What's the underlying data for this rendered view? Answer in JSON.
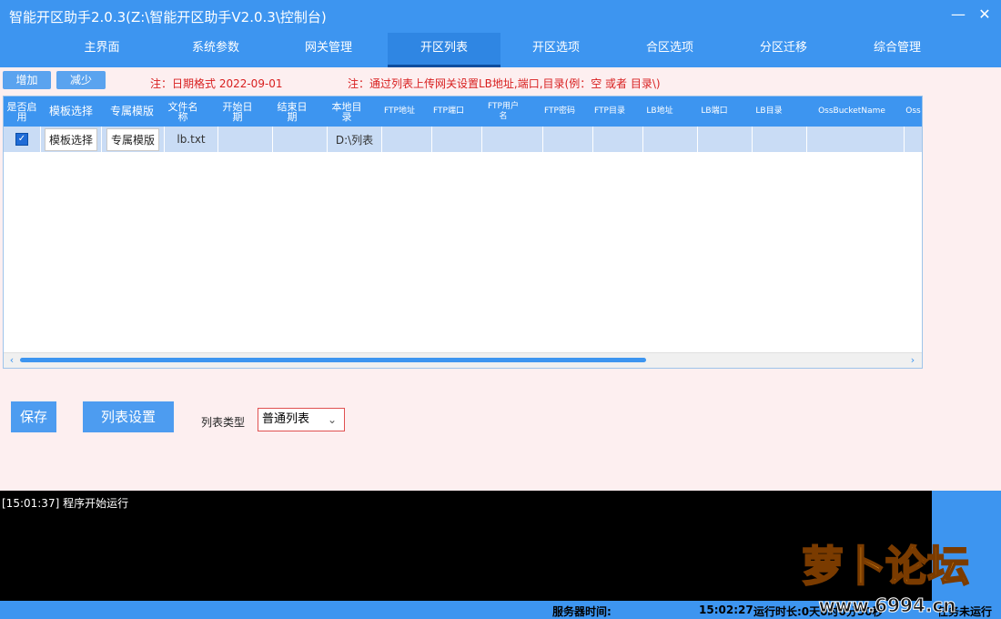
{
  "window": {
    "title": "智能开区助手2.0.3(Z:\\智能开区助手V2.0.3\\控制台)"
  },
  "nav": {
    "tabs": [
      "主界面",
      "系统参数",
      "网关管理",
      "开区列表",
      "开区选项",
      "合区选项",
      "分区迁移",
      "综合管理"
    ],
    "active": "开区列表"
  },
  "toolbar": {
    "add_label": "增加",
    "remove_label": "减少"
  },
  "notes": {
    "date_note": "注：日期格式 2022-09-01",
    "list_note": "注：通过列表上传网关设置LB地址,端口,目录(例：空 或者 目录\\)"
  },
  "table": {
    "headers": [
      "是否启用",
      "模板选择",
      "专属模版",
      "文件名称",
      "开始日期",
      "结束日期",
      "本地目录",
      "FTP地址",
      "FTP端口",
      "FTP用户名",
      "FTP密码",
      "FTP目录",
      "LB地址",
      "LB端口",
      "LB目录",
      "OssBucketName",
      "Oss"
    ],
    "row": {
      "enabled": true,
      "template_btn": "模板选择",
      "exclusive_btn": "专属模版",
      "file_name": "lb.txt",
      "local_dir": "D:\\列表"
    }
  },
  "actions": {
    "save_label": "保存",
    "list_settings_label": "列表设置",
    "list_type_label": "列表类型",
    "list_type_value": "普通列表"
  },
  "console": {
    "lines": [
      "[15:01:37] 程序开始运行"
    ]
  },
  "status": {
    "server_time_label": "服务器时间:",
    "time": "15:02:27",
    "runtime_label": "运行时长:0天0时0分50秒",
    "task_label": "任务未运行"
  },
  "watermark": {
    "text": "萝卜论坛",
    "url": "www.6994.cn"
  }
}
